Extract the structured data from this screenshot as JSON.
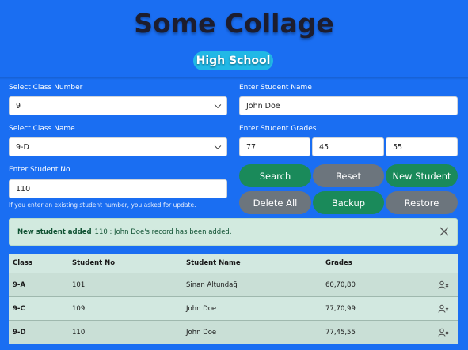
{
  "header": {
    "title": "Some Collage",
    "badge": "High School"
  },
  "form": {
    "class_number": {
      "label": "Select Class Number",
      "value": "9"
    },
    "student_name": {
      "label": "Enter Student Name",
      "value": "John Doe"
    },
    "class_name": {
      "label": "Select Class Name",
      "value": "9-D"
    },
    "grades": {
      "label": "Enter Student Grades",
      "values": [
        "77",
        "45",
        "55"
      ]
    },
    "student_no": {
      "label": "Enter Student No",
      "value": "110"
    },
    "hint": "If you enter an existing student number, you asked for update."
  },
  "buttons": {
    "search": "Search",
    "reset": "Reset",
    "new_student": "New Student",
    "delete_all": "Delete All",
    "backup": "Backup",
    "restore": "Restore"
  },
  "alert": {
    "title": "New student added",
    "message": "110 : John Doe's record has been added."
  },
  "table": {
    "headers": [
      "Class",
      "Student No",
      "Student Name",
      "Grades"
    ],
    "rows": [
      {
        "class": "9-A",
        "no": "101",
        "name": "Sinan Altundağ",
        "grades": "60,70,80"
      },
      {
        "class": "9-C",
        "no": "109",
        "name": "John Doe",
        "grades": "77,70,99"
      },
      {
        "class": "9-D",
        "no": "110",
        "name": "John Doe",
        "grades": "77,45,55"
      }
    ]
  },
  "icons": {
    "row_action": "remove-user-icon",
    "alert_close": "close-icon"
  },
  "colors": {
    "background": "#1a6ef2",
    "badge": "#21b8e6",
    "green": "#1a8a5a",
    "gray": "#6c757d",
    "alert_bg": "#d2eadf"
  }
}
